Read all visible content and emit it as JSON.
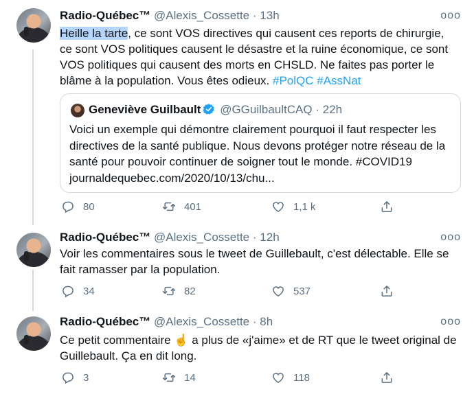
{
  "tweets": [
    {
      "name": "Radio-Québec™",
      "handle": "@Alexis_Cossette",
      "separator": "·",
      "time": "13h",
      "text_highlight": "Heille la tarte",
      "text_rest": ", ce sont VOS directives qui causent ces reports de chirurgie, ce sont VOS politiques causent le désastre et la ruine économique, ce sont VOS politiques qui causent des morts en CHSLD. Ne faites pas porter le blâme à la population. Vous êtes odieux. ",
      "hashtag1": "#PolQC",
      "hashtag2": "#AssNat",
      "quote": {
        "name": "Geneviève Guilbault",
        "handle": "@GGuilbaultCAQ",
        "separator": "·",
        "time": "22h",
        "text": "Voici un exemple qui démontre clairement pourquoi il faut respecter les directives de la santé publique. Nous devons protéger notre réseau de la santé pour pouvoir continuer de soigner tout le monde. #COVID19 journaldequebec.com/2020/10/13/chu..."
      },
      "replies": "80",
      "retweets": "401",
      "likes": "1,1 k",
      "more": "ooo"
    },
    {
      "name": "Radio-Québec™",
      "handle": "@Alexis_Cossette",
      "separator": "·",
      "time": "12h",
      "text": "Voir les commentaires sous le tweet de Guillebault, c'est délectable. Elle se fait ramasser par la population.",
      "replies": "34",
      "retweets": "82",
      "likes": "537",
      "more": "ooo"
    },
    {
      "name": "Radio-Québec™",
      "handle": "@Alexis_Cossette",
      "separator": "·",
      "time": "8h",
      "text_before": "Ce petit commentaire ",
      "emoji": "☝️",
      "text_after": " a plus de «j'aime» et de RT que le tweet original de Guillebault. Ça en dit long.",
      "replies": "3",
      "retweets": "14",
      "likes": "118",
      "more": "ooo"
    }
  ],
  "colors": {
    "accent": "#1da1f2",
    "muted": "#5b7083",
    "text": "#0f1419",
    "border": "#cfd9de",
    "selection": "#b4d5fe"
  },
  "icons": [
    "reply-icon",
    "retweet-icon",
    "like-icon",
    "share-icon",
    "more-icon",
    "verified-icon"
  ]
}
